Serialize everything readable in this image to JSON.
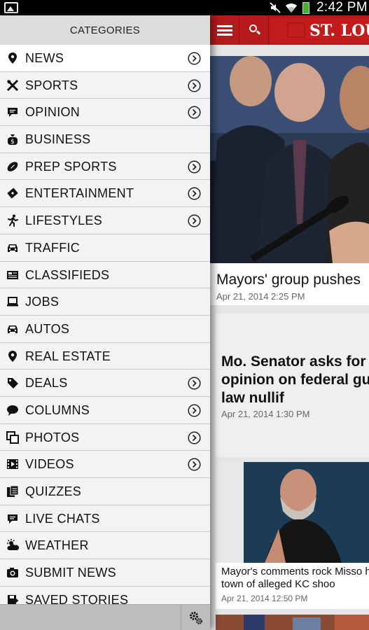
{
  "status_bar": {
    "time": "2:42 PM",
    "icons": [
      "gallery-icon",
      "mute-icon",
      "wifi-icon",
      "battery-icon"
    ],
    "battery_color": "#4caf2c"
  },
  "app_bar": {
    "logo_text": "ST. LOUI",
    "color": "#b71a1a",
    "icons": [
      "menu-icon",
      "search-icon"
    ]
  },
  "drawer": {
    "header": "CATEGORIES",
    "items": [
      {
        "label": "NEWS",
        "icon": "location-pin-icon",
        "has_chevron": true
      },
      {
        "label": "SPORTS",
        "icon": "crossed-bats-icon",
        "has_chevron": true
      },
      {
        "label": "OPINION",
        "icon": "speech-bubble-icon",
        "has_chevron": true
      },
      {
        "label": "BUSINESS",
        "icon": "money-bag-icon",
        "has_chevron": false
      },
      {
        "label": "PREP SPORTS",
        "icon": "football-icon",
        "has_chevron": true
      },
      {
        "label": "ENTERTAINMENT",
        "icon": "ticket-icon",
        "has_chevron": true
      },
      {
        "label": "LIFESTYLES",
        "icon": "runner-icon",
        "has_chevron": true
      },
      {
        "label": "TRAFFIC",
        "icon": "car-icon",
        "has_chevron": false
      },
      {
        "label": "CLASSIFIEDS",
        "icon": "newspaper-icon",
        "has_chevron": false
      },
      {
        "label": "JOBS",
        "icon": "laptop-icon",
        "has_chevron": false
      },
      {
        "label": "AUTOS",
        "icon": "car-icon",
        "has_chevron": false
      },
      {
        "label": "REAL ESTATE",
        "icon": "location-pin-icon",
        "has_chevron": false
      },
      {
        "label": "DEALS",
        "icon": "tag-icon",
        "has_chevron": true
      },
      {
        "label": "COLUMNS",
        "icon": "comment-icon",
        "has_chevron": true
      },
      {
        "label": "PHOTOS",
        "icon": "photos-icon",
        "has_chevron": true
      },
      {
        "label": "VIDEOS",
        "icon": "film-icon",
        "has_chevron": true
      },
      {
        "label": "QUIZZES",
        "icon": "documents-icon",
        "has_chevron": false
      },
      {
        "label": "LIVE CHATS",
        "icon": "chat-icon",
        "has_chevron": false
      },
      {
        "label": "WEATHER",
        "icon": "weather-icon",
        "has_chevron": false
      },
      {
        "label": "SUBMIT NEWS",
        "icon": "camera-icon",
        "has_chevron": false
      },
      {
        "label": "SAVED STORIES",
        "icon": "save-icon",
        "has_chevron": false
      }
    ],
    "footer_icon": "settings-icon"
  },
  "articles": [
    {
      "headline": "Mayors' group pushes",
      "date": "Apr 21, 2014 2:25 PM"
    },
    {
      "headline": "Mo. Senator asks for AG's opinion on federal gun law nullif",
      "date": "Apr 21, 2014 1:30 PM"
    },
    {
      "headline": "Mayor's comments rock Misso home town of alleged KC shoo",
      "date": "Apr 21, 2014 12:50 PM"
    }
  ]
}
